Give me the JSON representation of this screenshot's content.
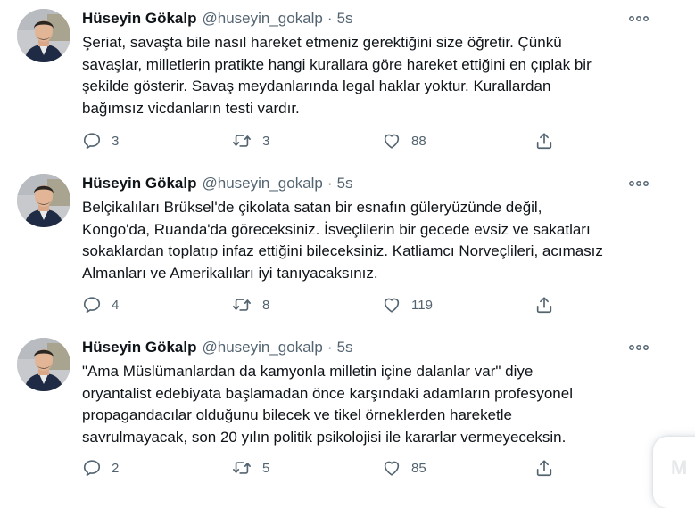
{
  "tweets": [
    {
      "author_name": "Hüseyin Gökalp",
      "author_handle": "@huseyin_gokalp",
      "separator": "·",
      "time": "5s",
      "lines": [
        "Şeriat, savaşta bile nasıl hareket etmeniz gerektiğini size öğretir. Çünkü",
        "savaşlar, milletlerin pratikte hangi kurallara göre hareket ettiğini en çıplak bir",
        "şekilde gösterir. Savaş meydanlarında legal haklar yoktur. Kurallardan",
        "bağımsız vicdanların testi vardır."
      ],
      "replies": "3",
      "retweets": "3",
      "likes": "88"
    },
    {
      "author_name": "Hüseyin Gökalp",
      "author_handle": "@huseyin_gokalp",
      "separator": "·",
      "time": "5s",
      "lines": [
        "Belçikalıları Brüksel'de çikolata satan bir esnafın güleryüzünde değil,",
        "Kongo'da, Ruanda'da göreceksiniz. İsveçlilerin bir gecede evsiz ve sakatları",
        "sokaklardan toplatıp infaz ettiğini bileceksiniz. Katliamcı Norveçlileri, acımasız",
        "Almanları ve Amerikalıları iyi tanıyacaksınız."
      ],
      "replies": "4",
      "retweets": "8",
      "likes": "119"
    },
    {
      "author_name": "Hüseyin Gökalp",
      "author_handle": "@huseyin_gokalp",
      "separator": "·",
      "time": "5s",
      "lines": [
        "\"Ama Müslümanlardan da kamyonla milletin içine dalanlar var\" diye",
        "oryantalist edebiyata başlamadan önce karşındaki adamların profesyonel",
        "propagandacılar olduğunu bilecek ve tikel örneklerden hareketle",
        "savrulmayacak, son 20 yılın politik psikolojisi ile kararlar vermeyeceksin."
      ],
      "replies": "2",
      "retweets": "5",
      "likes": "85"
    }
  ],
  "icons": {
    "more": "more-horizontal-icon",
    "reply": "reply-icon",
    "retweet": "retweet-icon",
    "like": "heart-icon",
    "share": "share-icon"
  },
  "colors": {
    "text": "#0f1419",
    "secondary": "#536471",
    "background": "#ffffff"
  },
  "corner_widget": {
    "label": "M"
  }
}
